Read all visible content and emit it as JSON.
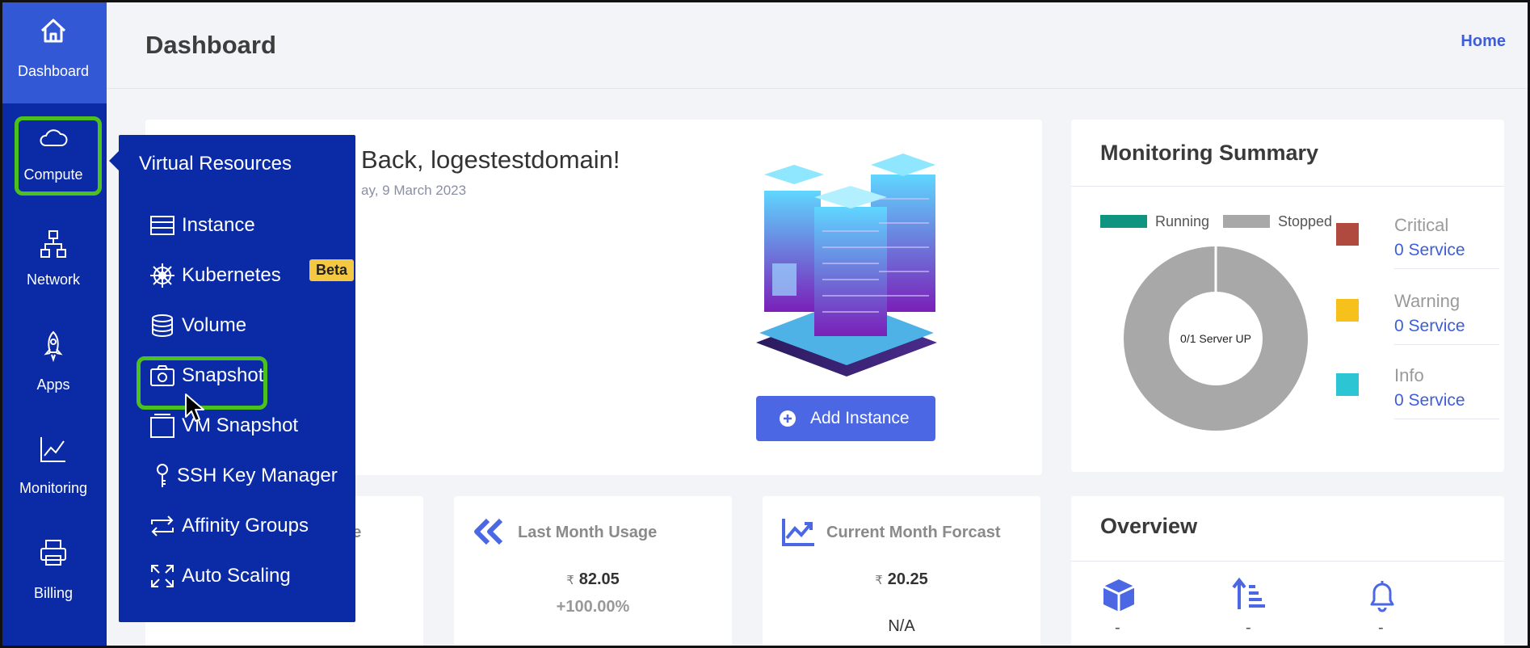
{
  "sidebar": {
    "items": [
      {
        "label": "Dashboard",
        "icon": "home-icon"
      },
      {
        "label": "Compute",
        "icon": "cloud-icon"
      },
      {
        "label": "Network",
        "icon": "network-icon"
      },
      {
        "label": "Apps",
        "icon": "rocket-icon"
      },
      {
        "label": "Monitoring",
        "icon": "chart-icon"
      },
      {
        "label": "Billing",
        "icon": "printer-icon"
      }
    ]
  },
  "header": {
    "title": "Dashboard",
    "home_link": "Home"
  },
  "welcome": {
    "title": "Back, logestestdomain!",
    "date": "ay, 9 March 2023",
    "add_button": "Add Instance"
  },
  "monitoring": {
    "title": "Monitoring Summary",
    "legend": [
      "Running",
      "Stopped"
    ],
    "donut_center": "0/1 Server UP",
    "statuses": [
      {
        "name": "Critical",
        "count": "0 Service",
        "color": "#b04a3f"
      },
      {
        "name": "Warning",
        "count": "0 Service",
        "color": "#f6c11a"
      },
      {
        "name": "Info",
        "count": "0 Service",
        "color": "#2bc5d4"
      }
    ]
  },
  "usage_cards": [
    {
      "title": "ge"
    },
    {
      "title": "Last Month Usage",
      "currency": "₹",
      "value": "82.05",
      "sub": "+100.00%"
    },
    {
      "title": "Current Month Forcast",
      "currency": "₹",
      "value": "20.25",
      "sub": "N/A"
    }
  ],
  "overview": {
    "title": "Overview",
    "values": [
      "-",
      "-",
      "-"
    ]
  },
  "flyout": {
    "title": "Virtual Resources",
    "items": [
      {
        "label": "Instance",
        "icon": "instance-icon"
      },
      {
        "label": "Kubernetes",
        "icon": "helm-icon",
        "badge": "Beta"
      },
      {
        "label": "Volume",
        "icon": "database-icon"
      },
      {
        "label": "Snapshot",
        "icon": "camera-icon"
      },
      {
        "label": "VM Snapshot",
        "icon": "vm-snapshot-icon"
      },
      {
        "label": "SSH Key Manager",
        "icon": "key-icon"
      },
      {
        "label": "Affinity Groups",
        "icon": "arrows-exchange-icon"
      },
      {
        "label": "Auto Scaling",
        "icon": "expand-icon"
      }
    ]
  },
  "colors": {
    "sidebar": "#0a2aa6",
    "active": "#3358d6",
    "accent": "#4b67e3",
    "highlight": "#4cc01e"
  }
}
